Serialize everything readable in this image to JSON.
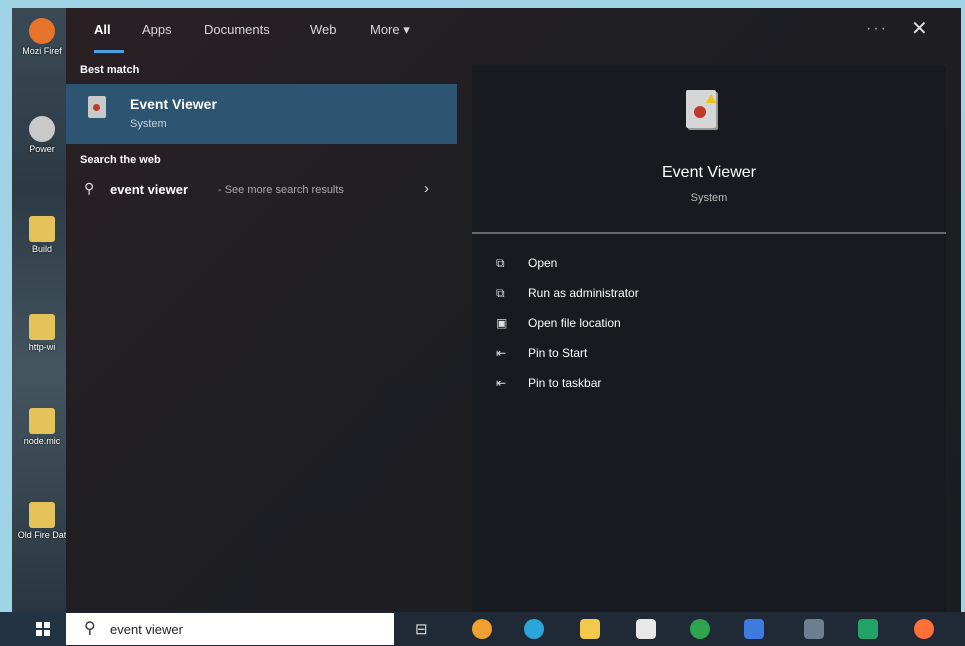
{
  "desktop": {
    "icons": [
      {
        "label": "Mozi Firef",
        "color": "#e8742b"
      },
      {
        "label": "Power",
        "color": "#c9c9c9"
      },
      {
        "label": "Build",
        "color": "#e6c35a"
      },
      {
        "label": "http-wi",
        "color": "#e6c35a"
      },
      {
        "label": "node.mic",
        "color": "#e6c35a"
      },
      {
        "label": "Old Fire Dat",
        "color": "#e6c35a"
      }
    ]
  },
  "tabs": [
    {
      "label": "All"
    },
    {
      "label": "Apps"
    },
    {
      "label": "Documents"
    },
    {
      "label": "Web"
    },
    {
      "label": "More ▾"
    }
  ],
  "top": {
    "more": "···",
    "close": "✕"
  },
  "best_match": {
    "heading": "Best match",
    "title": "Event Viewer",
    "subtitle": "System"
  },
  "web": {
    "heading": "Search the web",
    "query": "event viewer",
    "more": "- See more search results",
    "chevron": "›"
  },
  "preview": {
    "title": "Event Viewer",
    "subtitle": "System",
    "actions": [
      {
        "icon": "open-icon",
        "glyph": "⧉",
        "label": "Open"
      },
      {
        "icon": "run-admin-icon",
        "glyph": "⧉",
        "label": "Run as administrator"
      },
      {
        "icon": "file-location-icon",
        "glyph": "▣",
        "label": "Open file location"
      },
      {
        "icon": "pin-icon",
        "glyph": "⇤",
        "label": "Pin to Start"
      },
      {
        "icon": "pin-icon",
        "glyph": "⇤",
        "label": "Pin to taskbar"
      }
    ]
  },
  "taskbar": {
    "search_text": "event viewer",
    "apps": [
      {
        "name": "app-1",
        "color": "#f0a030"
      },
      {
        "name": "edge",
        "color": "#2aa6d8"
      },
      {
        "name": "file-explorer",
        "color": "#f2c94c"
      },
      {
        "name": "store",
        "color": "#e8e8e8"
      },
      {
        "name": "chrome",
        "color": "#2ea44f"
      },
      {
        "name": "remote-desktop",
        "color": "#3d7be0"
      },
      {
        "name": "calculator",
        "color": "#6d7f8f"
      },
      {
        "name": "excel",
        "color": "#21a366"
      },
      {
        "name": "firefox",
        "color": "#ff7139"
      }
    ]
  }
}
